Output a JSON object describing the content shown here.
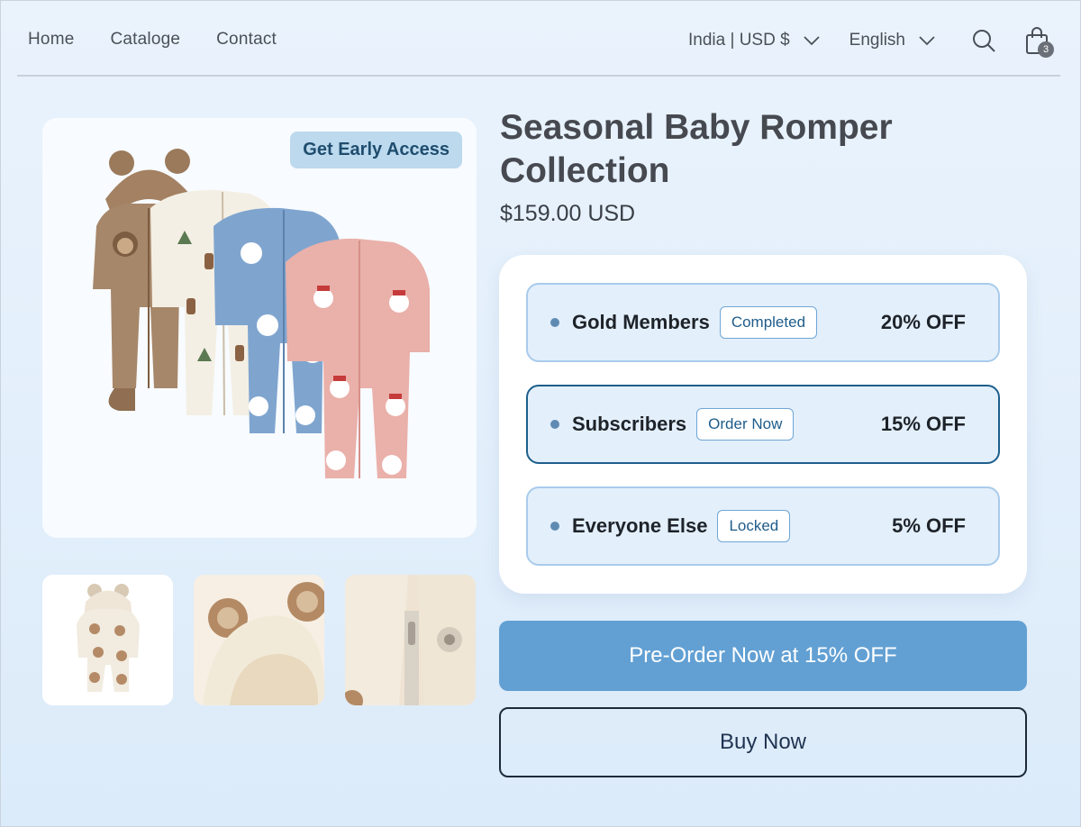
{
  "nav": {
    "home": "Home",
    "catalog": "Cataloge",
    "contact": "Contact"
  },
  "header": {
    "country_currency": "India | USD $",
    "language": "English",
    "cart_count": "3"
  },
  "gallery": {
    "badge": "Get Early Access",
    "thumbnails": [
      "bear-pattern-romper",
      "bear-ear-hood-closeup",
      "zipper-fleece-closeup"
    ]
  },
  "product": {
    "title": "Seasonal Baby Romper Collection",
    "price": "$159.00 USD"
  },
  "tiers": [
    {
      "name": "Gold Members",
      "status": "Completed",
      "discount": "20% OFF"
    },
    {
      "name": "Subscribers",
      "status": "Order Now",
      "discount": "15% OFF"
    },
    {
      "name": "Everyone Else",
      "status": "Locked",
      "discount": "5% OFF"
    }
  ],
  "actions": {
    "preorder": "Pre-Order Now at 15% OFF",
    "buy": "Buy Now"
  },
  "colors": {
    "accent": "#62a0d3",
    "active_border": "#1d5f8c",
    "badge_bg": "#bcd9ee"
  },
  "icons": [
    "search-icon",
    "cart-icon",
    "chevron-down-icon"
  ]
}
